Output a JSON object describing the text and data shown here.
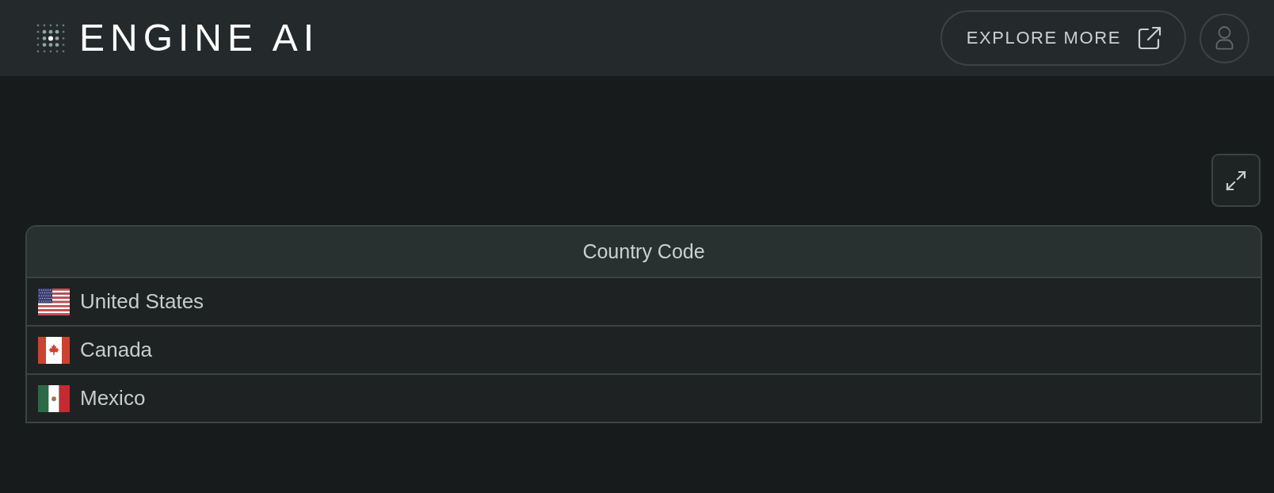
{
  "header": {
    "logo_text": "ENGINE AI",
    "explore_button": "EXPLORE MORE"
  },
  "table": {
    "columns": [
      "Country Code"
    ],
    "rows": [
      {
        "kind": "us",
        "country": "United States"
      },
      {
        "kind": "canada",
        "country": "Canada"
      },
      {
        "kind": "mexico",
        "country": "Mexico"
      }
    ]
  }
}
